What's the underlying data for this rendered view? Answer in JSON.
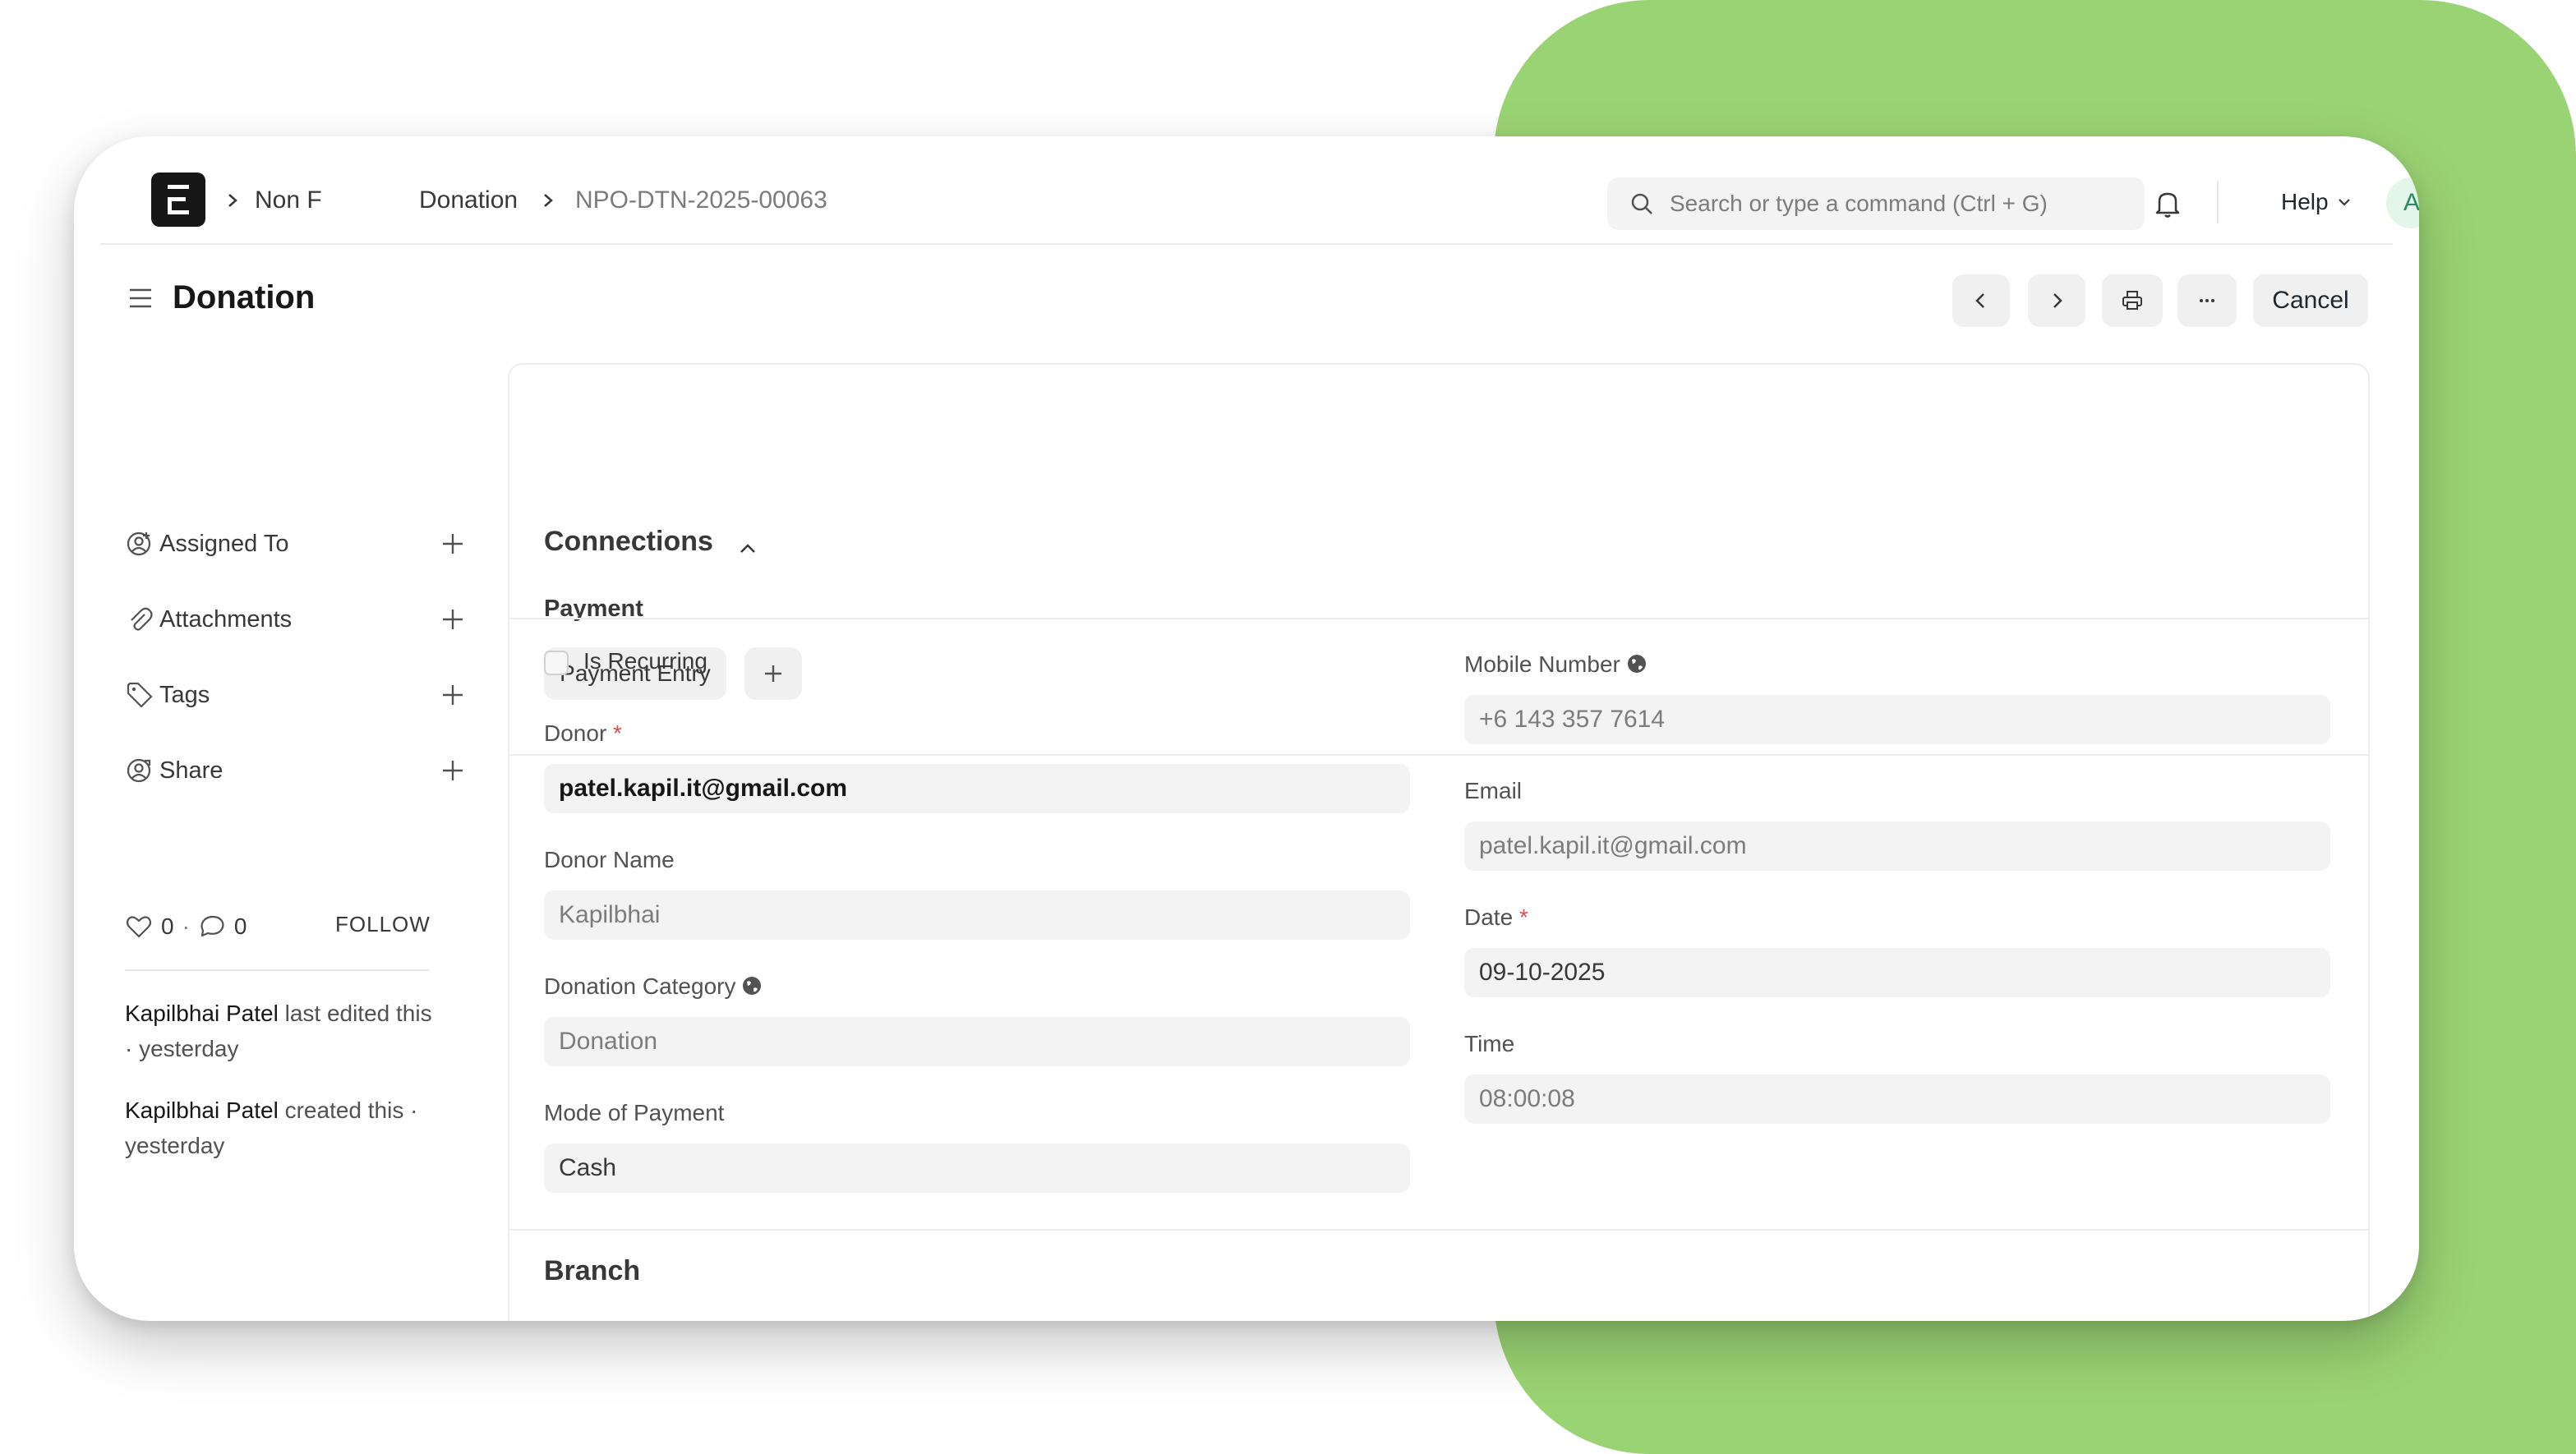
{
  "navbar": {
    "breadcrumbs": [
      "Non F",
      "Donation",
      "NPO-DTN-2025-00063"
    ],
    "search_placeholder": "Search or type a command (Ctrl + G)",
    "help_label": "Help",
    "avatar_initial": "A"
  },
  "page": {
    "title": "Donation",
    "cancel_label": "Cancel"
  },
  "sidebar": {
    "items": [
      {
        "label": "Assigned To",
        "icon": "assign-icon"
      },
      {
        "label": "Attachments",
        "icon": "paperclip-icon"
      },
      {
        "label": "Tags",
        "icon": "tag-icon"
      },
      {
        "label": "Share",
        "icon": "share-icon"
      }
    ],
    "likes": "0",
    "comments": "0",
    "follow_label": "FOLLOW",
    "activity": [
      {
        "user": "Kapilbhai Patel",
        "text": "last edited this · yesterday"
      },
      {
        "user": "Kapilbhai Patel",
        "text": "created this · yesterday"
      }
    ]
  },
  "connections": {
    "title": "Connections",
    "group_label": "Payment",
    "payment_entry_label": "Payment Entry"
  },
  "form": {
    "is_recurring_label": "Is Recurring",
    "donor_label": "Donor",
    "donor_value": "patel.kapil.it@gmail.com",
    "donor_name_label": "Donor Name",
    "donor_name_value": "Kapilbhai",
    "donation_category_label": "Donation Category",
    "donation_category_value": "Donation",
    "mode_of_payment_label": "Mode of Payment",
    "mode_of_payment_value": "Cash",
    "mobile_number_label": "Mobile Number",
    "mobile_number_value": "+6 143 357 7614",
    "email_label": "Email",
    "email_value": "patel.kapil.it@gmail.com",
    "date_label": "Date",
    "date_value": "09-10-2025",
    "time_label": "Time",
    "time_value": "08:00:08",
    "branch_section_title": "Branch"
  },
  "colors": {
    "backdrop_green": "#9ad373",
    "required_red": "#e2494b",
    "avatar_bg": "#e4f5e9",
    "avatar_fg": "#278f5e"
  }
}
